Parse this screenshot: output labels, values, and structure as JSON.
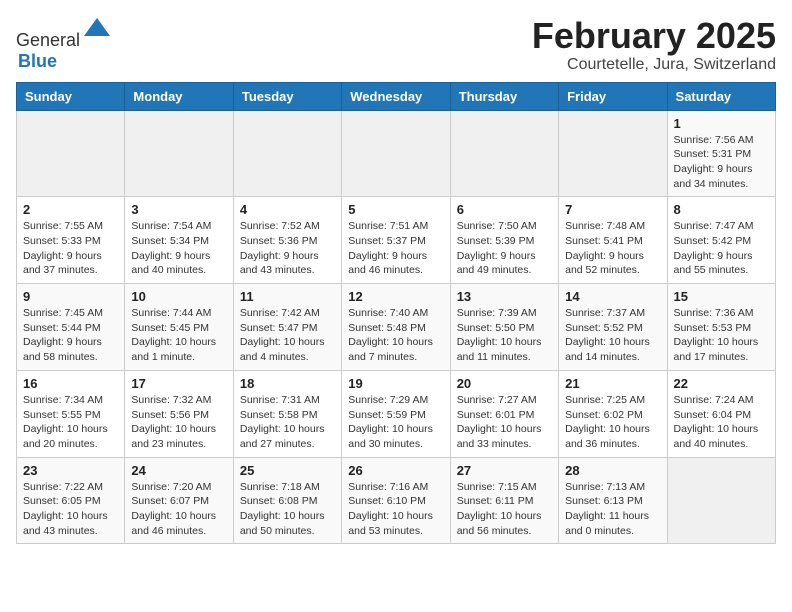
{
  "header": {
    "logo_general": "General",
    "logo_blue": "Blue",
    "month": "February 2025",
    "location": "Courtetelle, Jura, Switzerland"
  },
  "weekdays": [
    "Sunday",
    "Monday",
    "Tuesday",
    "Wednesday",
    "Thursday",
    "Friday",
    "Saturday"
  ],
  "weeks": [
    [
      {
        "day": "",
        "info": ""
      },
      {
        "day": "",
        "info": ""
      },
      {
        "day": "",
        "info": ""
      },
      {
        "day": "",
        "info": ""
      },
      {
        "day": "",
        "info": ""
      },
      {
        "day": "",
        "info": ""
      },
      {
        "day": "1",
        "info": "Sunrise: 7:56 AM\nSunset: 5:31 PM\nDaylight: 9 hours and 34 minutes."
      }
    ],
    [
      {
        "day": "2",
        "info": "Sunrise: 7:55 AM\nSunset: 5:33 PM\nDaylight: 9 hours and 37 minutes."
      },
      {
        "day": "3",
        "info": "Sunrise: 7:54 AM\nSunset: 5:34 PM\nDaylight: 9 hours and 40 minutes."
      },
      {
        "day": "4",
        "info": "Sunrise: 7:52 AM\nSunset: 5:36 PM\nDaylight: 9 hours and 43 minutes."
      },
      {
        "day": "5",
        "info": "Sunrise: 7:51 AM\nSunset: 5:37 PM\nDaylight: 9 hours and 46 minutes."
      },
      {
        "day": "6",
        "info": "Sunrise: 7:50 AM\nSunset: 5:39 PM\nDaylight: 9 hours and 49 minutes."
      },
      {
        "day": "7",
        "info": "Sunrise: 7:48 AM\nSunset: 5:41 PM\nDaylight: 9 hours and 52 minutes."
      },
      {
        "day": "8",
        "info": "Sunrise: 7:47 AM\nSunset: 5:42 PM\nDaylight: 9 hours and 55 minutes."
      }
    ],
    [
      {
        "day": "9",
        "info": "Sunrise: 7:45 AM\nSunset: 5:44 PM\nDaylight: 9 hours and 58 minutes."
      },
      {
        "day": "10",
        "info": "Sunrise: 7:44 AM\nSunset: 5:45 PM\nDaylight: 10 hours and 1 minute."
      },
      {
        "day": "11",
        "info": "Sunrise: 7:42 AM\nSunset: 5:47 PM\nDaylight: 10 hours and 4 minutes."
      },
      {
        "day": "12",
        "info": "Sunrise: 7:40 AM\nSunset: 5:48 PM\nDaylight: 10 hours and 7 minutes."
      },
      {
        "day": "13",
        "info": "Sunrise: 7:39 AM\nSunset: 5:50 PM\nDaylight: 10 hours and 11 minutes."
      },
      {
        "day": "14",
        "info": "Sunrise: 7:37 AM\nSunset: 5:52 PM\nDaylight: 10 hours and 14 minutes."
      },
      {
        "day": "15",
        "info": "Sunrise: 7:36 AM\nSunset: 5:53 PM\nDaylight: 10 hours and 17 minutes."
      }
    ],
    [
      {
        "day": "16",
        "info": "Sunrise: 7:34 AM\nSunset: 5:55 PM\nDaylight: 10 hours and 20 minutes."
      },
      {
        "day": "17",
        "info": "Sunrise: 7:32 AM\nSunset: 5:56 PM\nDaylight: 10 hours and 23 minutes."
      },
      {
        "day": "18",
        "info": "Sunrise: 7:31 AM\nSunset: 5:58 PM\nDaylight: 10 hours and 27 minutes."
      },
      {
        "day": "19",
        "info": "Sunrise: 7:29 AM\nSunset: 5:59 PM\nDaylight: 10 hours and 30 minutes."
      },
      {
        "day": "20",
        "info": "Sunrise: 7:27 AM\nSunset: 6:01 PM\nDaylight: 10 hours and 33 minutes."
      },
      {
        "day": "21",
        "info": "Sunrise: 7:25 AM\nSunset: 6:02 PM\nDaylight: 10 hours and 36 minutes."
      },
      {
        "day": "22",
        "info": "Sunrise: 7:24 AM\nSunset: 6:04 PM\nDaylight: 10 hours and 40 minutes."
      }
    ],
    [
      {
        "day": "23",
        "info": "Sunrise: 7:22 AM\nSunset: 6:05 PM\nDaylight: 10 hours and 43 minutes."
      },
      {
        "day": "24",
        "info": "Sunrise: 7:20 AM\nSunset: 6:07 PM\nDaylight: 10 hours and 46 minutes."
      },
      {
        "day": "25",
        "info": "Sunrise: 7:18 AM\nSunset: 6:08 PM\nDaylight: 10 hours and 50 minutes."
      },
      {
        "day": "26",
        "info": "Sunrise: 7:16 AM\nSunset: 6:10 PM\nDaylight: 10 hours and 53 minutes."
      },
      {
        "day": "27",
        "info": "Sunrise: 7:15 AM\nSunset: 6:11 PM\nDaylight: 10 hours and 56 minutes."
      },
      {
        "day": "28",
        "info": "Sunrise: 7:13 AM\nSunset: 6:13 PM\nDaylight: 11 hours and 0 minutes."
      },
      {
        "day": "",
        "info": ""
      }
    ]
  ]
}
